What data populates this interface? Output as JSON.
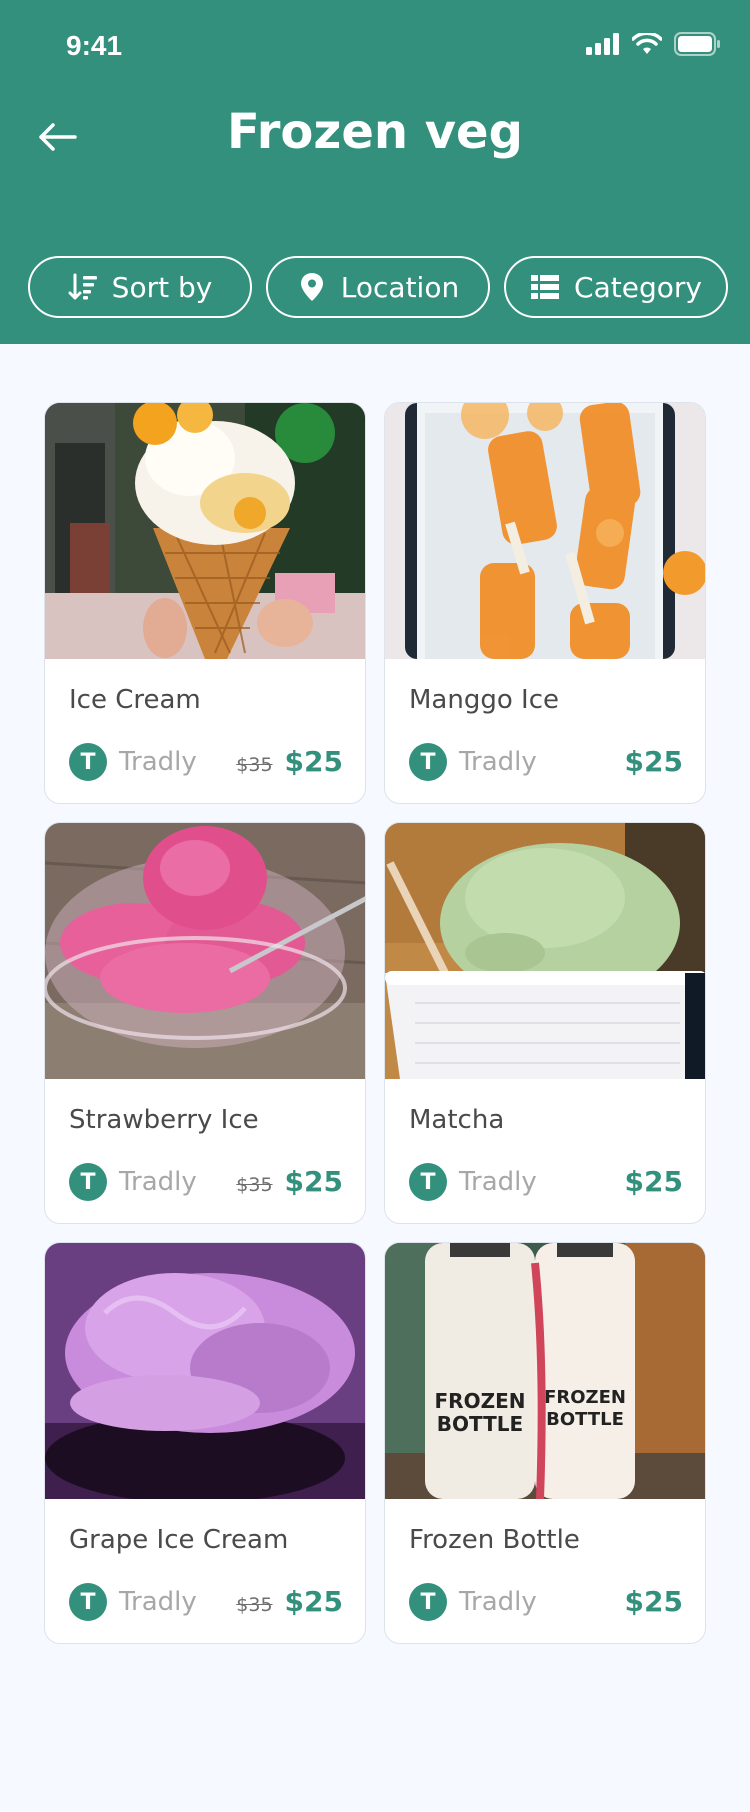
{
  "status": {
    "time": "9:41"
  },
  "header": {
    "title": "Frozen veg"
  },
  "filters": [
    {
      "label": "Sort by",
      "icon": "sort-icon"
    },
    {
      "label": "Location",
      "icon": "location-pin-icon"
    },
    {
      "label": "Category",
      "icon": "category-list-icon"
    }
  ],
  "colors": {
    "brand": "#33907C",
    "background": "#F6F9FF"
  },
  "products": [
    {
      "name": "Ice Cream",
      "seller": "Tradly",
      "seller_initial": "T",
      "old_price": "$35",
      "price": "$25"
    },
    {
      "name": "Manggo Ice",
      "seller": "Tradly",
      "seller_initial": "T",
      "old_price": "",
      "price": "$25"
    },
    {
      "name": "Strawberry Ice",
      "seller": "Tradly",
      "seller_initial": "T",
      "old_price": "$35",
      "price": "$25"
    },
    {
      "name": "Matcha",
      "seller": "Tradly",
      "seller_initial": "T",
      "old_price": "",
      "price": "$25"
    },
    {
      "name": "Grape Ice Cream",
      "seller": "Tradly",
      "seller_initial": "T",
      "old_price": "$35",
      "price": "$25"
    },
    {
      "name": "Frozen Bottle",
      "seller": "Tradly",
      "seller_initial": "T",
      "old_price": "",
      "price": "$25"
    }
  ],
  "images": {
    "bottle_label_top": "FROZEN",
    "bottle_label_bottom": "BOTTLE"
  }
}
